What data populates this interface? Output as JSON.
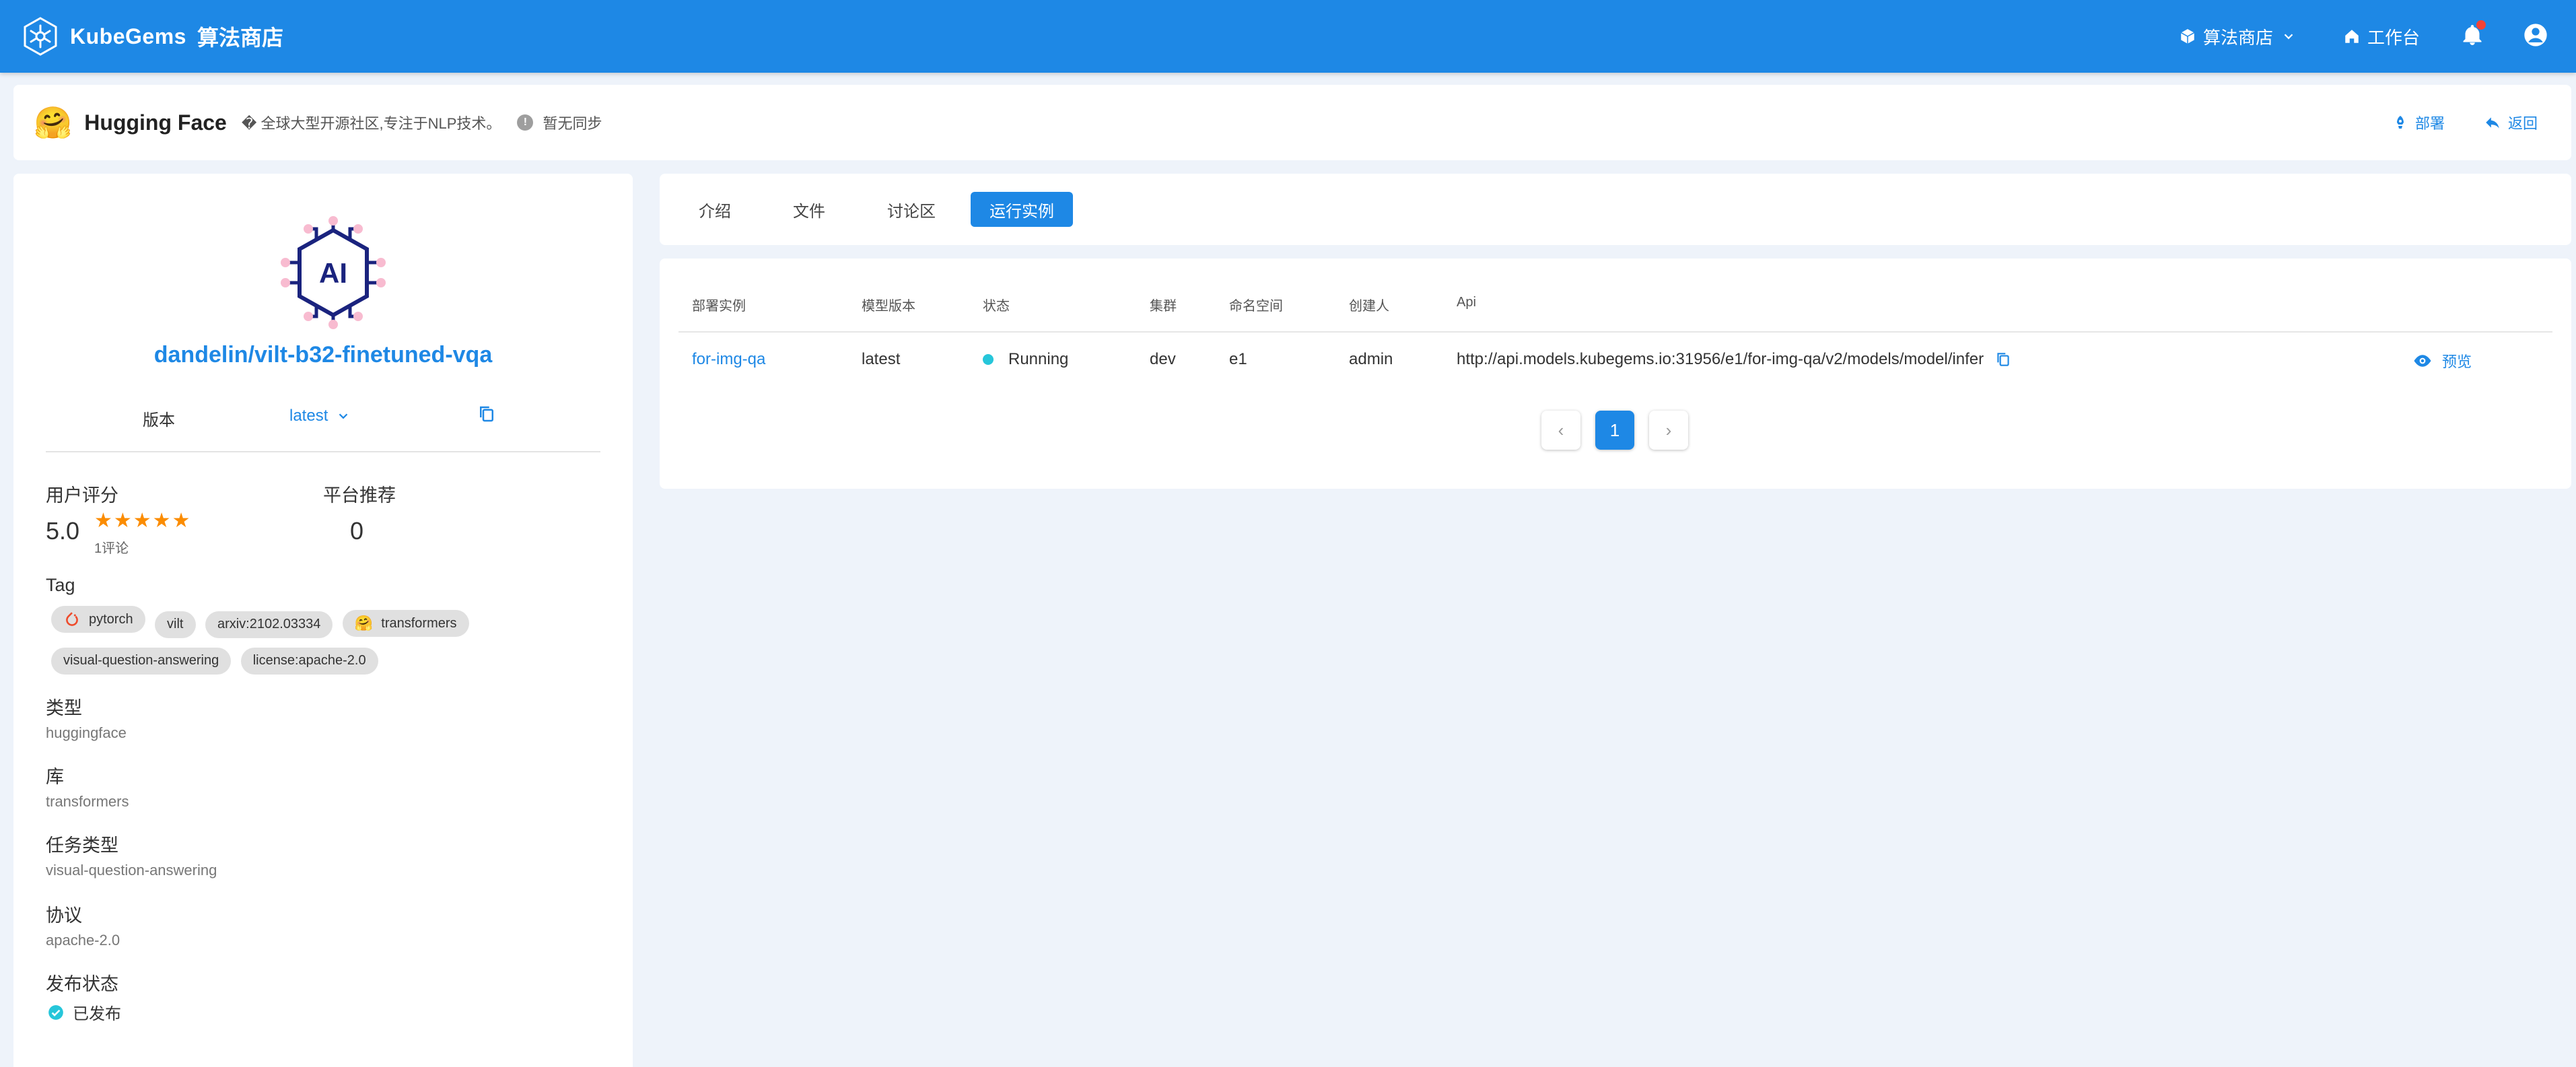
{
  "app": {
    "brand": "KubeGems",
    "subtitle": "算法商店",
    "nav": {
      "store": "算法商店",
      "workbench": "工作台"
    }
  },
  "header": {
    "emoji": "🤗",
    "title": "Hugging Face",
    "description": "� 全球大型开源社区,专注于NLP技术。",
    "sync_status": "暂无同步",
    "deploy_label": "部署",
    "back_label": "返回"
  },
  "model": {
    "name": "dandelin/vilt-b32-finetuned-vqa",
    "version_label": "版本",
    "version_value": "latest",
    "rating_label": "用户评分",
    "rating_value": "5.0",
    "stars": "★★★★★",
    "review_count": "1评论",
    "recommend_label": "平台推荐",
    "recommend_value": "0",
    "tag_label": "Tag",
    "tags": [
      "pytorch",
      "vilt",
      "arxiv:2102.03334",
      "transformers",
      "visual-question-answering",
      "license:apache-2.0"
    ],
    "type_label": "类型",
    "type_value": "huggingface",
    "library_label": "库",
    "library_value": "transformers",
    "task_label": "任务类型",
    "task_value": "visual-question-answering",
    "license_label": "协议",
    "license_value": "apache-2.0",
    "publish_label": "发布状态",
    "publish_value": "已发布"
  },
  "tabs": [
    "介绍",
    "文件",
    "讨论区",
    "运行实例"
  ],
  "table": {
    "headers": [
      "部署实例",
      "模型版本",
      "状态",
      "集群",
      "命名空间",
      "创建人",
      "Api"
    ],
    "rows": [
      {
        "instance": "for-img-qa",
        "version": "latest",
        "status": "Running",
        "cluster": "dev",
        "namespace": "e1",
        "creator": "admin",
        "api": "http://api.models.kubegems.io:31956/e1/for-img-qa/v2/models/model/infer",
        "action": "预览"
      }
    ]
  },
  "pagination": {
    "current": "1",
    "prev": "‹",
    "next": "›"
  },
  "colors": {
    "primary": "#1e88e5",
    "star": "#fb8c00",
    "running": "#26c6da"
  }
}
